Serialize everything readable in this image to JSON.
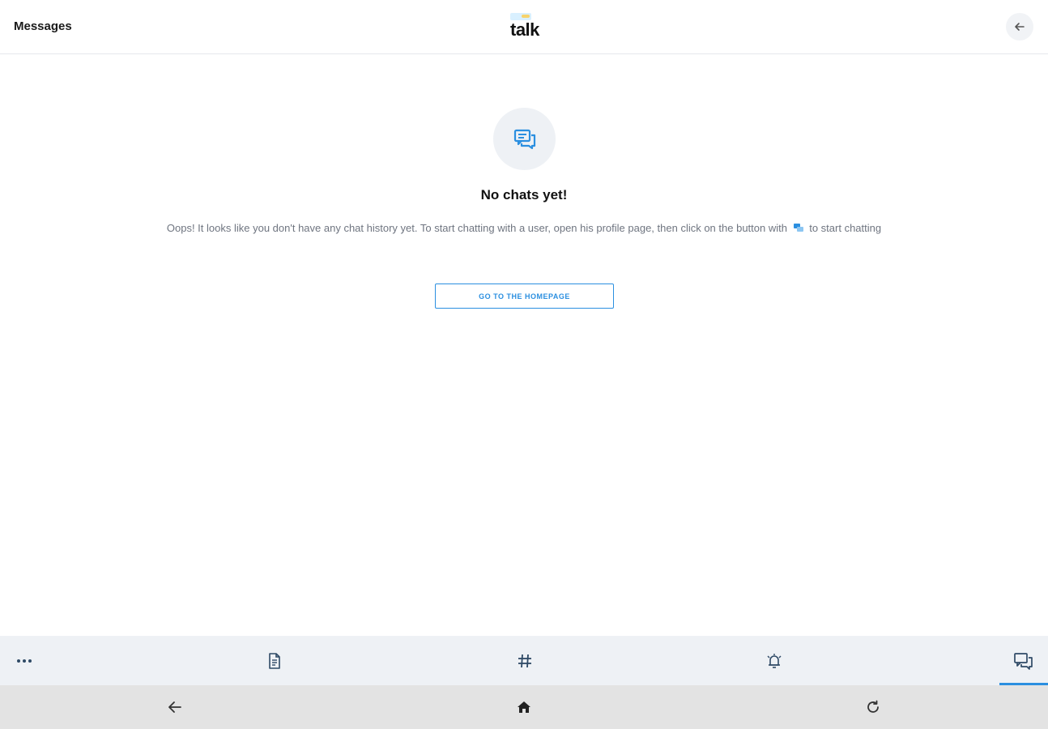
{
  "header": {
    "title": "Messages",
    "logo_text": "talk",
    "back_icon": "arrow-left-icon"
  },
  "empty_state": {
    "icon": "chat-bubbles-icon",
    "title": "No chats yet!",
    "description_before": "Oops! It looks like you don't have any chat history yet. To start chatting with a user, open his profile page, then click on the button with",
    "description_after": "to start chatting",
    "button_label": "GO TO THE HOMEPAGE"
  },
  "tabbar": {
    "tabs": [
      {
        "icon": "more-dots-icon",
        "active": false
      },
      {
        "icon": "document-icon",
        "active": false
      },
      {
        "icon": "hashtag-icon",
        "active": false
      },
      {
        "icon": "alarm-bell-icon",
        "active": false
      },
      {
        "icon": "chat-bubbles-icon",
        "active": true
      }
    ]
  },
  "system_nav": {
    "buttons": [
      "back-arrow-icon",
      "home-icon",
      "reload-icon"
    ]
  },
  "colors": {
    "accent": "#2b8fe0",
    "tabbar_bg": "#eef1f5",
    "sysnav_bg": "#e3e3e3",
    "muted_text": "#6f7580"
  }
}
